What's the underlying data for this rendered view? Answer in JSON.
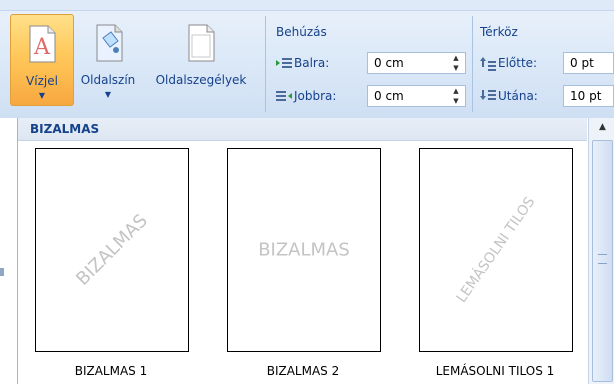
{
  "ribbon": {
    "watermark_button": {
      "label": "Vízjel",
      "arrow": "▼"
    },
    "page_color_button": {
      "label": "Oldalszín",
      "arrow": "▼"
    },
    "page_borders_button": {
      "label": "Oldalszegélyek"
    },
    "indent": {
      "title": "Behúzás",
      "left_label": "Balra:",
      "left_value": "0 cm",
      "right_label": "Jobbra:",
      "right_value": "0 cm"
    },
    "spacing": {
      "title": "Térköz",
      "before_label": "Előtte:",
      "before_value": "0 pt",
      "after_label": "Utána:",
      "after_value": "10 pt"
    }
  },
  "gallery": {
    "section_title": "BIZALMAS",
    "items": [
      {
        "watermark": "BIZALMAS",
        "caption": "BIZALMAS 1"
      },
      {
        "watermark": "BIZALMAS",
        "caption": "BIZALMAS 2"
      },
      {
        "watermark": "LEMÁSOLNI TILOS",
        "caption": "LEMÁSOLNI TILOS 1"
      }
    ]
  },
  "colors": {
    "accent_text": "#15428b",
    "selected_button": "#ffc85a",
    "ribbon_bg": "#d9e7f7"
  }
}
